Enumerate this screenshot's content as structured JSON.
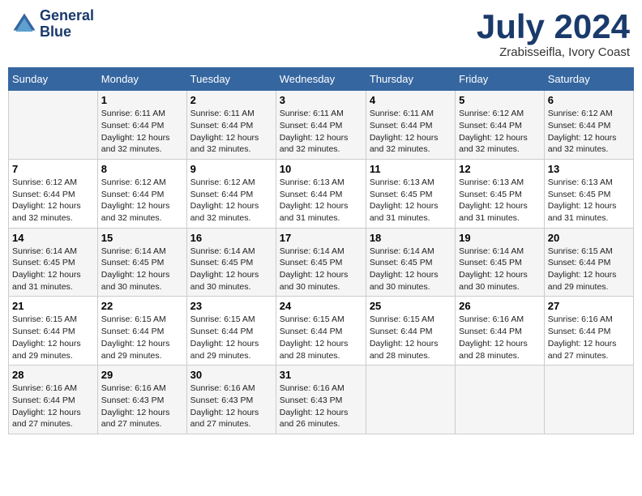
{
  "header": {
    "logo_line1": "General",
    "logo_line2": "Blue",
    "month_year": "July 2024",
    "location": "Zrabisseifla, Ivory Coast"
  },
  "days_of_week": [
    "Sunday",
    "Monday",
    "Tuesday",
    "Wednesday",
    "Thursday",
    "Friday",
    "Saturday"
  ],
  "weeks": [
    [
      {
        "day": "",
        "sunrise": "",
        "sunset": "",
        "daylight": ""
      },
      {
        "day": "1",
        "sunrise": "Sunrise: 6:11 AM",
        "sunset": "Sunset: 6:44 PM",
        "daylight": "Daylight: 12 hours and 32 minutes."
      },
      {
        "day": "2",
        "sunrise": "Sunrise: 6:11 AM",
        "sunset": "Sunset: 6:44 PM",
        "daylight": "Daylight: 12 hours and 32 minutes."
      },
      {
        "day": "3",
        "sunrise": "Sunrise: 6:11 AM",
        "sunset": "Sunset: 6:44 PM",
        "daylight": "Daylight: 12 hours and 32 minutes."
      },
      {
        "day": "4",
        "sunrise": "Sunrise: 6:11 AM",
        "sunset": "Sunset: 6:44 PM",
        "daylight": "Daylight: 12 hours and 32 minutes."
      },
      {
        "day": "5",
        "sunrise": "Sunrise: 6:12 AM",
        "sunset": "Sunset: 6:44 PM",
        "daylight": "Daylight: 12 hours and 32 minutes."
      },
      {
        "day": "6",
        "sunrise": "Sunrise: 6:12 AM",
        "sunset": "Sunset: 6:44 PM",
        "daylight": "Daylight: 12 hours and 32 minutes."
      }
    ],
    [
      {
        "day": "7",
        "sunrise": "Sunrise: 6:12 AM",
        "sunset": "Sunset: 6:44 PM",
        "daylight": "Daylight: 12 hours and 32 minutes."
      },
      {
        "day": "8",
        "sunrise": "Sunrise: 6:12 AM",
        "sunset": "Sunset: 6:44 PM",
        "daylight": "Daylight: 12 hours and 32 minutes."
      },
      {
        "day": "9",
        "sunrise": "Sunrise: 6:12 AM",
        "sunset": "Sunset: 6:44 PM",
        "daylight": "Daylight: 12 hours and 32 minutes."
      },
      {
        "day": "10",
        "sunrise": "Sunrise: 6:13 AM",
        "sunset": "Sunset: 6:44 PM",
        "daylight": "Daylight: 12 hours and 31 minutes."
      },
      {
        "day": "11",
        "sunrise": "Sunrise: 6:13 AM",
        "sunset": "Sunset: 6:45 PM",
        "daylight": "Daylight: 12 hours and 31 minutes."
      },
      {
        "day": "12",
        "sunrise": "Sunrise: 6:13 AM",
        "sunset": "Sunset: 6:45 PM",
        "daylight": "Daylight: 12 hours and 31 minutes."
      },
      {
        "day": "13",
        "sunrise": "Sunrise: 6:13 AM",
        "sunset": "Sunset: 6:45 PM",
        "daylight": "Daylight: 12 hours and 31 minutes."
      }
    ],
    [
      {
        "day": "14",
        "sunrise": "Sunrise: 6:14 AM",
        "sunset": "Sunset: 6:45 PM",
        "daylight": "Daylight: 12 hours and 31 minutes."
      },
      {
        "day": "15",
        "sunrise": "Sunrise: 6:14 AM",
        "sunset": "Sunset: 6:45 PM",
        "daylight": "Daylight: 12 hours and 30 minutes."
      },
      {
        "day": "16",
        "sunrise": "Sunrise: 6:14 AM",
        "sunset": "Sunset: 6:45 PM",
        "daylight": "Daylight: 12 hours and 30 minutes."
      },
      {
        "day": "17",
        "sunrise": "Sunrise: 6:14 AM",
        "sunset": "Sunset: 6:45 PM",
        "daylight": "Daylight: 12 hours and 30 minutes."
      },
      {
        "day": "18",
        "sunrise": "Sunrise: 6:14 AM",
        "sunset": "Sunset: 6:45 PM",
        "daylight": "Daylight: 12 hours and 30 minutes."
      },
      {
        "day": "19",
        "sunrise": "Sunrise: 6:14 AM",
        "sunset": "Sunset: 6:45 PM",
        "daylight": "Daylight: 12 hours and 30 minutes."
      },
      {
        "day": "20",
        "sunrise": "Sunrise: 6:15 AM",
        "sunset": "Sunset: 6:44 PM",
        "daylight": "Daylight: 12 hours and 29 minutes."
      }
    ],
    [
      {
        "day": "21",
        "sunrise": "Sunrise: 6:15 AM",
        "sunset": "Sunset: 6:44 PM",
        "daylight": "Daylight: 12 hours and 29 minutes."
      },
      {
        "day": "22",
        "sunrise": "Sunrise: 6:15 AM",
        "sunset": "Sunset: 6:44 PM",
        "daylight": "Daylight: 12 hours and 29 minutes."
      },
      {
        "day": "23",
        "sunrise": "Sunrise: 6:15 AM",
        "sunset": "Sunset: 6:44 PM",
        "daylight": "Daylight: 12 hours and 29 minutes."
      },
      {
        "day": "24",
        "sunrise": "Sunrise: 6:15 AM",
        "sunset": "Sunset: 6:44 PM",
        "daylight": "Daylight: 12 hours and 28 minutes."
      },
      {
        "day": "25",
        "sunrise": "Sunrise: 6:15 AM",
        "sunset": "Sunset: 6:44 PM",
        "daylight": "Daylight: 12 hours and 28 minutes."
      },
      {
        "day": "26",
        "sunrise": "Sunrise: 6:16 AM",
        "sunset": "Sunset: 6:44 PM",
        "daylight": "Daylight: 12 hours and 28 minutes."
      },
      {
        "day": "27",
        "sunrise": "Sunrise: 6:16 AM",
        "sunset": "Sunset: 6:44 PM",
        "daylight": "Daylight: 12 hours and 27 minutes."
      }
    ],
    [
      {
        "day": "28",
        "sunrise": "Sunrise: 6:16 AM",
        "sunset": "Sunset: 6:44 PM",
        "daylight": "Daylight: 12 hours and 27 minutes."
      },
      {
        "day": "29",
        "sunrise": "Sunrise: 6:16 AM",
        "sunset": "Sunset: 6:43 PM",
        "daylight": "Daylight: 12 hours and 27 minutes."
      },
      {
        "day": "30",
        "sunrise": "Sunrise: 6:16 AM",
        "sunset": "Sunset: 6:43 PM",
        "daylight": "Daylight: 12 hours and 27 minutes."
      },
      {
        "day": "31",
        "sunrise": "Sunrise: 6:16 AM",
        "sunset": "Sunset: 6:43 PM",
        "daylight": "Daylight: 12 hours and 26 minutes."
      },
      {
        "day": "",
        "sunrise": "",
        "sunset": "",
        "daylight": ""
      },
      {
        "day": "",
        "sunrise": "",
        "sunset": "",
        "daylight": ""
      },
      {
        "day": "",
        "sunrise": "",
        "sunset": "",
        "daylight": ""
      }
    ]
  ]
}
